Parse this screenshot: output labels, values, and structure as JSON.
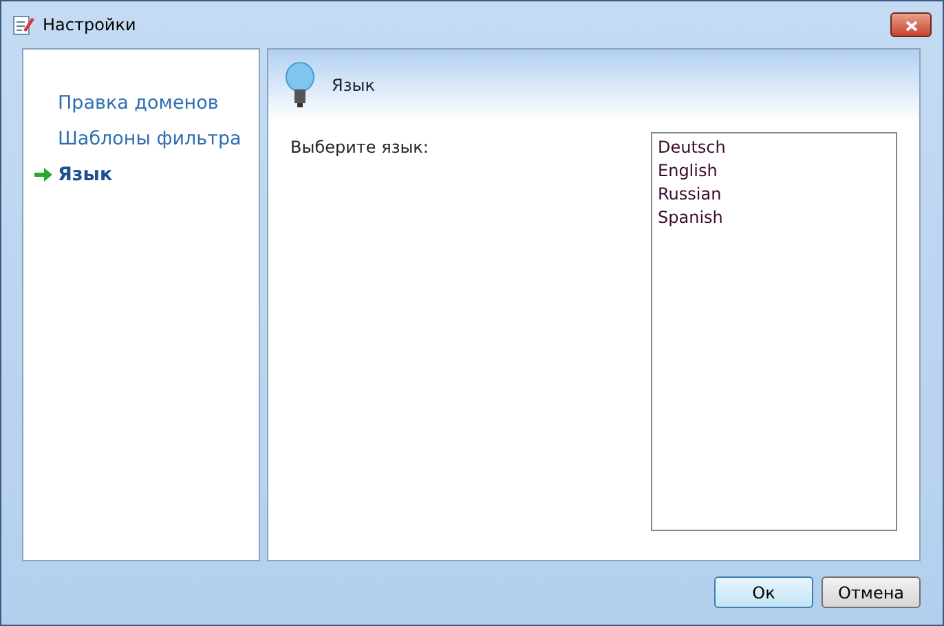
{
  "window": {
    "title": "Настройки"
  },
  "sidebar": {
    "items": [
      {
        "label": "Правка доменов",
        "selected": false
      },
      {
        "label": "Шаблоны фильтра",
        "selected": false
      },
      {
        "label": "Язык",
        "selected": true
      }
    ]
  },
  "panel": {
    "title": "Язык",
    "prompt": "Выберите язык:",
    "languages": [
      "Deutsch",
      "English",
      "Russian",
      "Spanish"
    ]
  },
  "buttons": [
    {
      "label": "Ок",
      "default": true
    },
    {
      "label": "Отмена",
      "default": false
    }
  ]
}
